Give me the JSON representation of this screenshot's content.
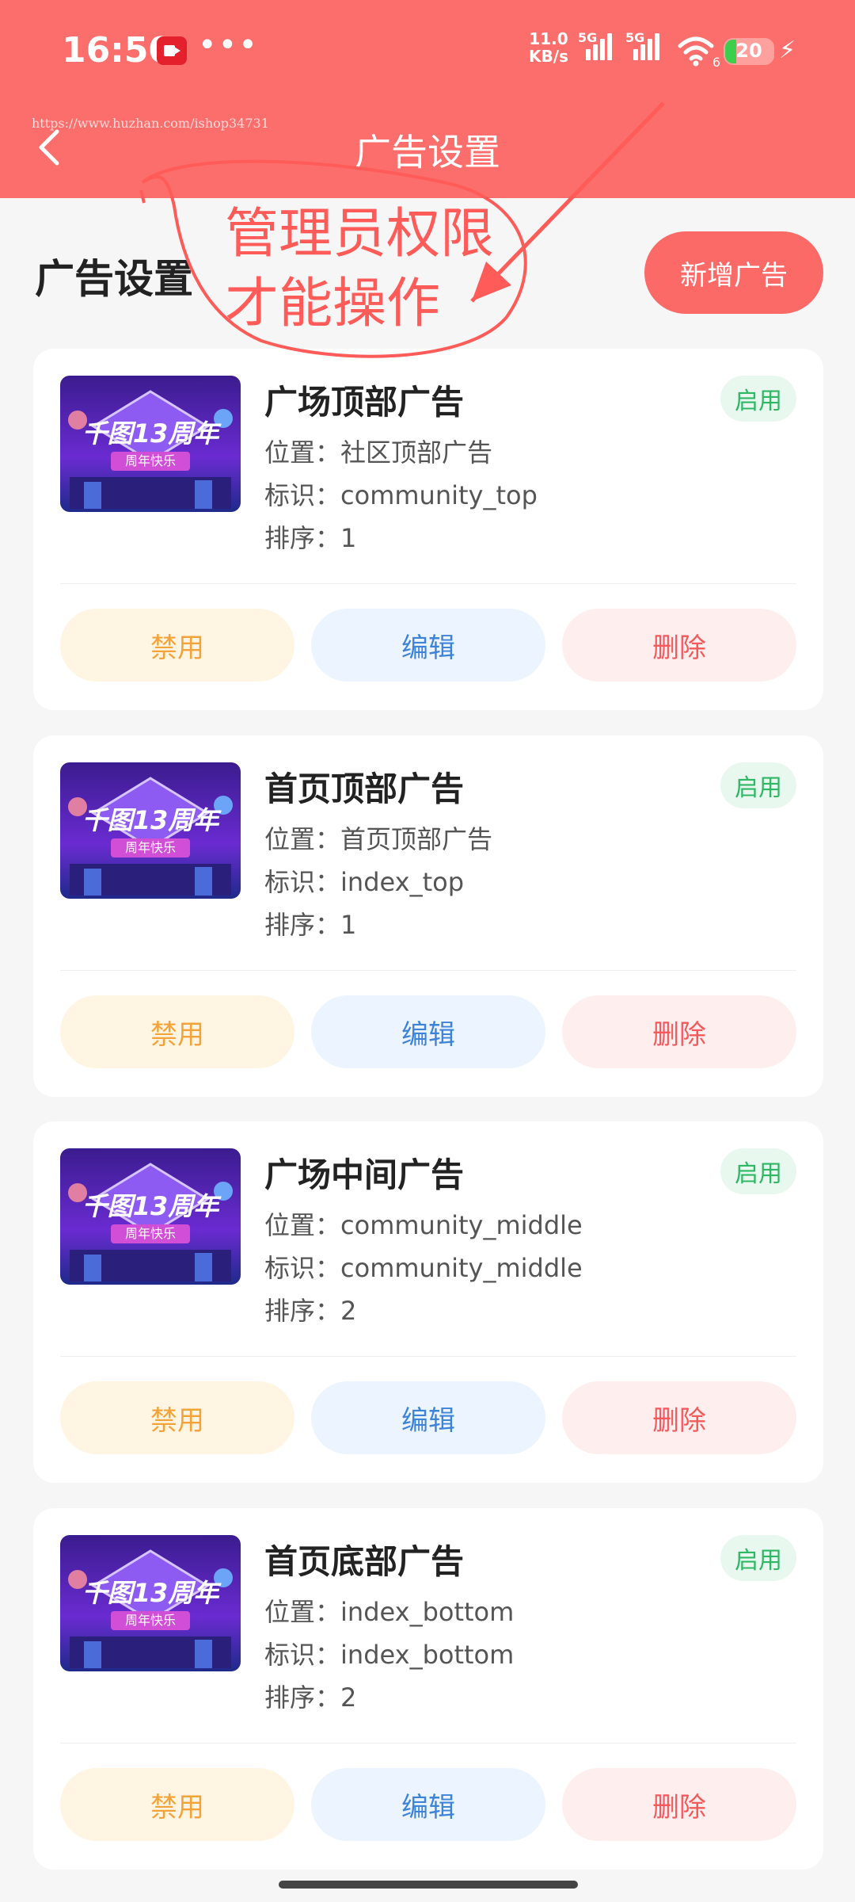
{
  "status_bar": {
    "time": "16:50",
    "speed_value": "11.0",
    "speed_unit": "KB/s",
    "signal_1_label": "5G",
    "signal_2_label": "5G",
    "wifi_badge": "6",
    "battery_level": "20"
  },
  "nav": {
    "title": "广告设置",
    "watermark_url": "https://www.huzhan.com/ishop34731"
  },
  "page": {
    "section_title": "广告设置",
    "add_button_label": "新增广告"
  },
  "annotation": {
    "line1": "管理员权限",
    "line2": "才能操作",
    "color": "#ff5b58"
  },
  "labels": {
    "position": "位置：",
    "key": "标识：",
    "order": "排序："
  },
  "ads": [
    {
      "title": "广场顶部广告",
      "status": "启用",
      "position": "社区顶部广告",
      "key": "community_top",
      "order": "1",
      "actions": {
        "disable": "禁用",
        "edit": "编辑",
        "delete": "删除"
      }
    },
    {
      "title": "首页顶部广告",
      "status": "启用",
      "position": "首页顶部广告",
      "key": "index_top",
      "order": "1",
      "actions": {
        "disable": "禁用",
        "edit": "编辑",
        "delete": "删除"
      }
    },
    {
      "title": "广场中间广告",
      "status": "启用",
      "position": "community_middle",
      "key": "community_middle",
      "order": "2",
      "actions": {
        "disable": "禁用",
        "edit": "编辑",
        "delete": "删除"
      }
    },
    {
      "title": "首页底部广告",
      "status": "启用",
      "position": "index_bottom",
      "key": "index_bottom",
      "order": "2",
      "actions": {
        "disable": "禁用",
        "edit": "编辑",
        "delete": "删除"
      }
    }
  ],
  "thumbnail": {
    "banner_text": "千图13周年",
    "ribbon_text": "周年快乐"
  },
  "colors": {
    "header": "#fc6e6b",
    "accent": "#fc6a68",
    "enabled": "#2fb765",
    "disable": "#f4a338",
    "edit": "#3d84d8",
    "delete": "#f25b5b"
  }
}
